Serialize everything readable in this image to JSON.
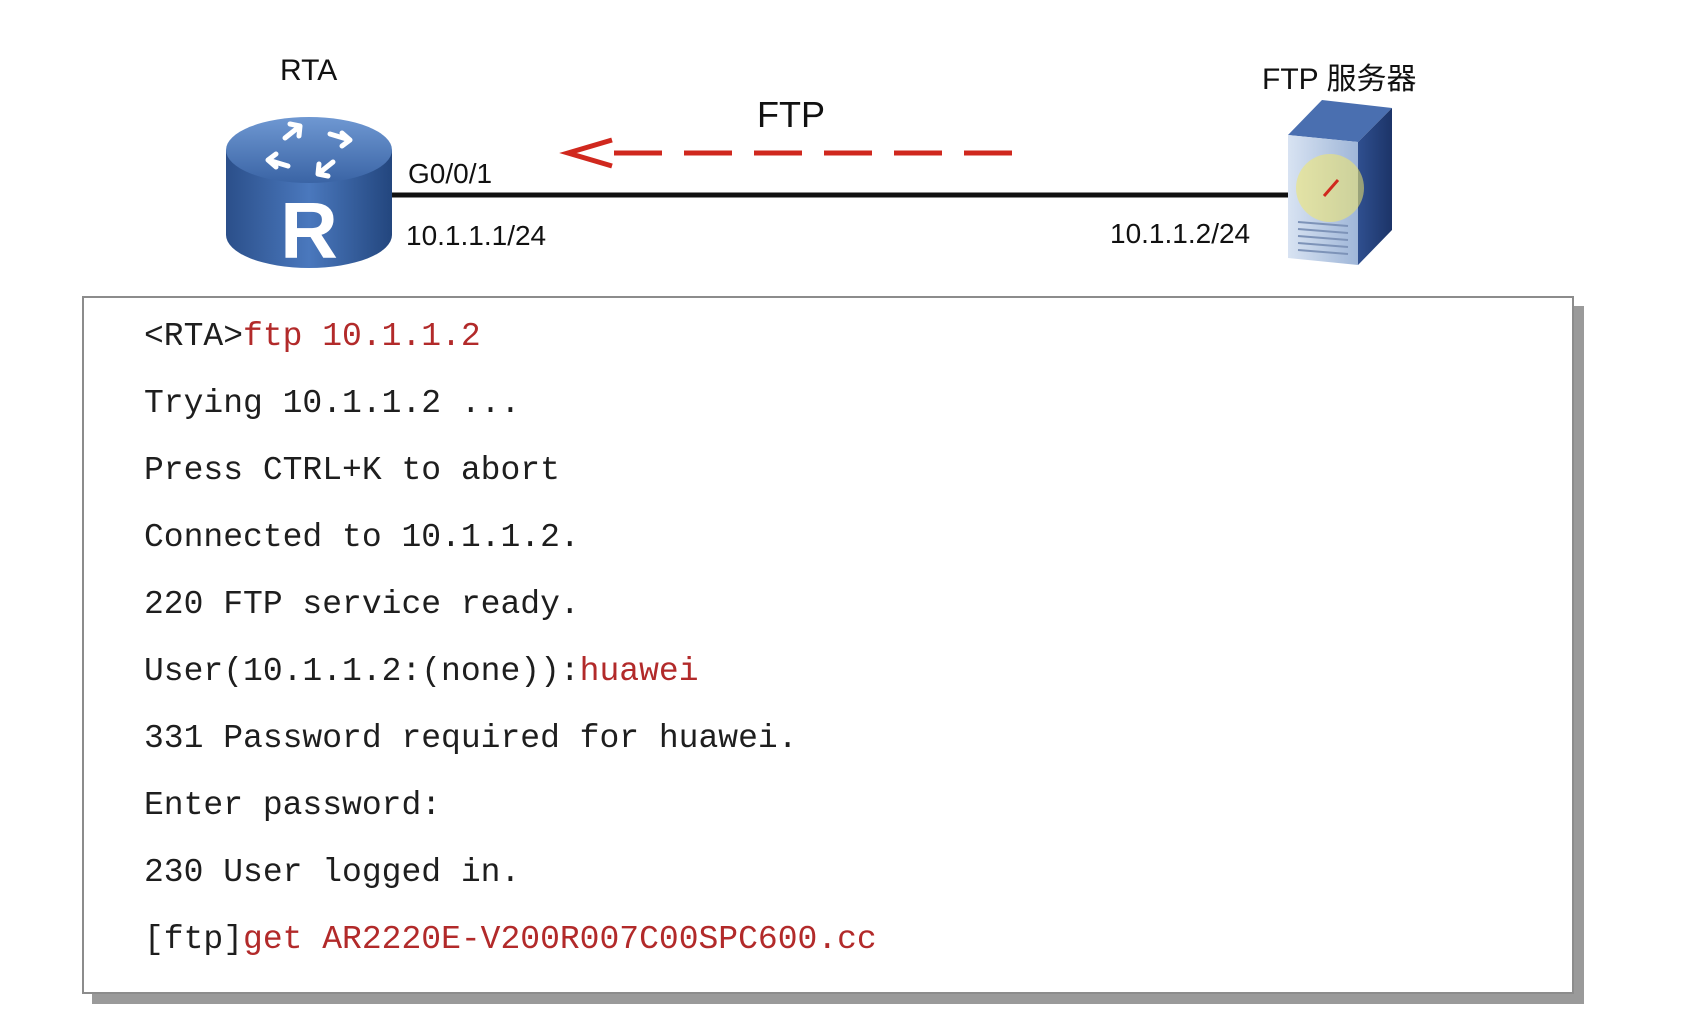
{
  "topology": {
    "router_label": "RTA",
    "server_label": "FTP 服务器",
    "protocol_label": "FTP",
    "router_interface": "G0/0/1",
    "router_ip": "10.1.1.1/24",
    "server_ip": "10.1.1.2/24",
    "router_icon": "router-icon",
    "server_icon": "server-icon",
    "router_glyph": "R",
    "arrow_color": "#d0281e",
    "router_color": "#3d67a8",
    "server_color": "#2e4f8c"
  },
  "console": {
    "command_color": "#b22a2a",
    "lines": [
      {
        "prefix": "<RTA>",
        "command": "ftp 10.1.1.2"
      },
      {
        "prefix": "Trying 10.1.1.2 ...",
        "command": ""
      },
      {
        "prefix": "Press CTRL+K to abort",
        "command": ""
      },
      {
        "prefix": "Connected to 10.1.1.2.",
        "command": ""
      },
      {
        "prefix": "220 FTP service ready.",
        "command": ""
      },
      {
        "prefix": "User(10.1.1.2:(none)):",
        "command": "huawei"
      },
      {
        "prefix": "331 Password required for huawei.",
        "command": ""
      },
      {
        "prefix": "Enter password:",
        "command": ""
      },
      {
        "prefix": "230 User logged in.",
        "command": ""
      },
      {
        "prefix": "[ftp]",
        "command": "get AR2220E-V200R007C00SPC600.cc"
      }
    ]
  }
}
